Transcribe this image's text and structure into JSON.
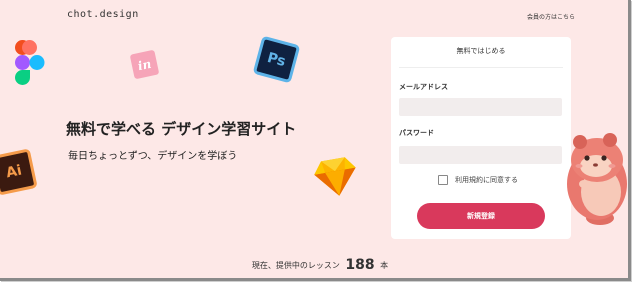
{
  "header": {
    "logo": "chot.design",
    "member_link": "会員の方はこちら"
  },
  "hero": {
    "headline": "無料で学べる デザイン学習サイト",
    "subline": "毎日ちょっとずつ、デザインを学ぼう"
  },
  "decor_icons": [
    {
      "name": "figma-icon"
    },
    {
      "name": "invision-icon",
      "text": "in"
    },
    {
      "name": "photoshop-icon",
      "text": "Ps"
    },
    {
      "name": "illustrator-icon",
      "text": "Ai"
    },
    {
      "name": "sketch-icon"
    }
  ],
  "signup_panel": {
    "title": "無料ではじめる",
    "email_label": "メールアドレス",
    "email_value": "",
    "password_label": "パスワード",
    "password_value": "",
    "agree_label": "利用規約に同意する",
    "agree_checked": false,
    "submit_label": "新規登録"
  },
  "footer": {
    "prefix": "現在、提供中のレッスン",
    "count": "188",
    "suffix": "本"
  },
  "colors": {
    "background": "#fde8e7",
    "accent": "#d9395c",
    "input_bg": "#f2eded"
  }
}
